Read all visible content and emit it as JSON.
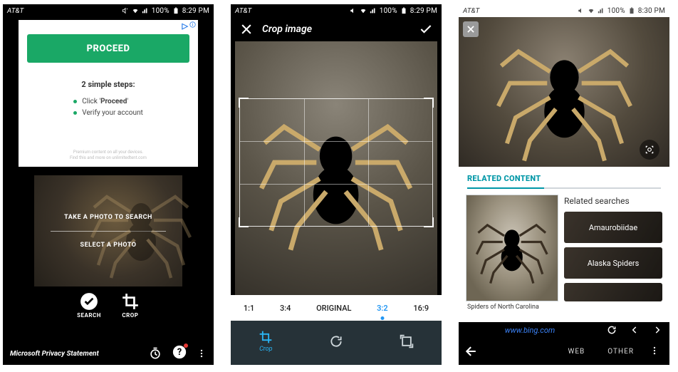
{
  "statusbar": {
    "carrier": "AT&T",
    "battery_pct": "100%",
    "time_a": "8:29 PM",
    "time_b": "8:29 PM",
    "time_c": "8:30 PM"
  },
  "screen1": {
    "ad": {
      "close_glyph": "▷",
      "proceed_label": "PROCEED",
      "steps_title": "2 simple steps:",
      "step1_prefix": "Click '",
      "step1_bold": "Proceed",
      "step1_suffix": "'",
      "step2": "Verify your account",
      "fineprint1": "Premium content on all your devices.",
      "fineprint2": "Find this and more on unlimitedtent.com"
    },
    "photo": {
      "take_label": "TAKE A PHOTO TO SEARCH",
      "select_label": "SELECT A PHOTO"
    },
    "tool_search": "SEARCH",
    "tool_crop": "CROP",
    "privacy_label": "Microsoft Privacy Statement"
  },
  "screen2": {
    "title": "Crop image",
    "ratios": {
      "r1": "1:1",
      "r2": "3:4",
      "r3": "ORIGINAL",
      "r4": "3:2",
      "r5": "16:9",
      "active_index": 3
    },
    "crop_label": "Crop"
  },
  "screen3": {
    "tab_header": "RELATED CONTENT",
    "card_caption": "Spiders of North Carolina",
    "related_title": "Related searches",
    "chip1": "Amaurobiidae",
    "chip2": "Alaska Spiders",
    "url": "www.bing.com",
    "tab_web": "WEB",
    "tab_other": "OTHER"
  },
  "colors": {
    "accent_green": "#1aa866",
    "accent_blue": "#2196f3",
    "accent_teal": "#0097a7"
  }
}
